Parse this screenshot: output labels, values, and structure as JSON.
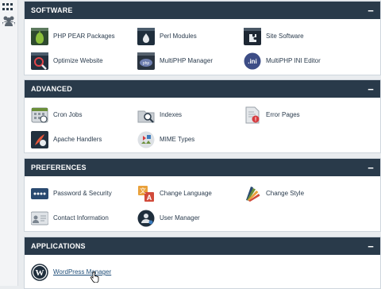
{
  "sections": [
    {
      "title": "SOFTWARE",
      "collapse_symbol": "−",
      "items": [
        {
          "label": "PHP PEAR Packages",
          "icon": "php-pear-icon"
        },
        {
          "label": "Perl Modules",
          "icon": "perl-modules-icon"
        },
        {
          "label": "Site Software",
          "icon": "site-software-icon"
        },
        {
          "label": "Optimize Website",
          "icon": "optimize-website-icon"
        },
        {
          "label": "MultiPHP Manager",
          "icon": "multiphp-manager-icon"
        },
        {
          "label": "MultiPHP INI Editor",
          "icon": "multiphp-ini-icon"
        }
      ]
    },
    {
      "title": "ADVANCED",
      "collapse_symbol": "−",
      "items": [
        {
          "label": "Cron Jobs",
          "icon": "cron-jobs-icon"
        },
        {
          "label": "Indexes",
          "icon": "indexes-icon"
        },
        {
          "label": "Error Pages",
          "icon": "error-pages-icon"
        },
        {
          "label": "Apache Handlers",
          "icon": "apache-handlers-icon"
        },
        {
          "label": "MIME Types",
          "icon": "mime-types-icon"
        }
      ]
    },
    {
      "title": "PREFERENCES",
      "collapse_symbol": "−",
      "items": [
        {
          "label": "Password & Security",
          "icon": "password-security-icon"
        },
        {
          "label": "Change Language",
          "icon": "change-language-icon"
        },
        {
          "label": "Change Style",
          "icon": "change-style-icon"
        },
        {
          "label": "Contact Information",
          "icon": "contact-information-icon"
        },
        {
          "label": "User Manager",
          "icon": "user-manager-icon"
        }
      ]
    },
    {
      "title": "APPLICATIONS",
      "collapse_symbol": "−",
      "items": [
        {
          "label": "WordPress Manager",
          "icon": "wordpress-icon"
        }
      ]
    }
  ],
  "colors": {
    "header_bg": "#293a4a",
    "page_bg": "#e9ecef",
    "label_text": "#2a3b4d"
  }
}
